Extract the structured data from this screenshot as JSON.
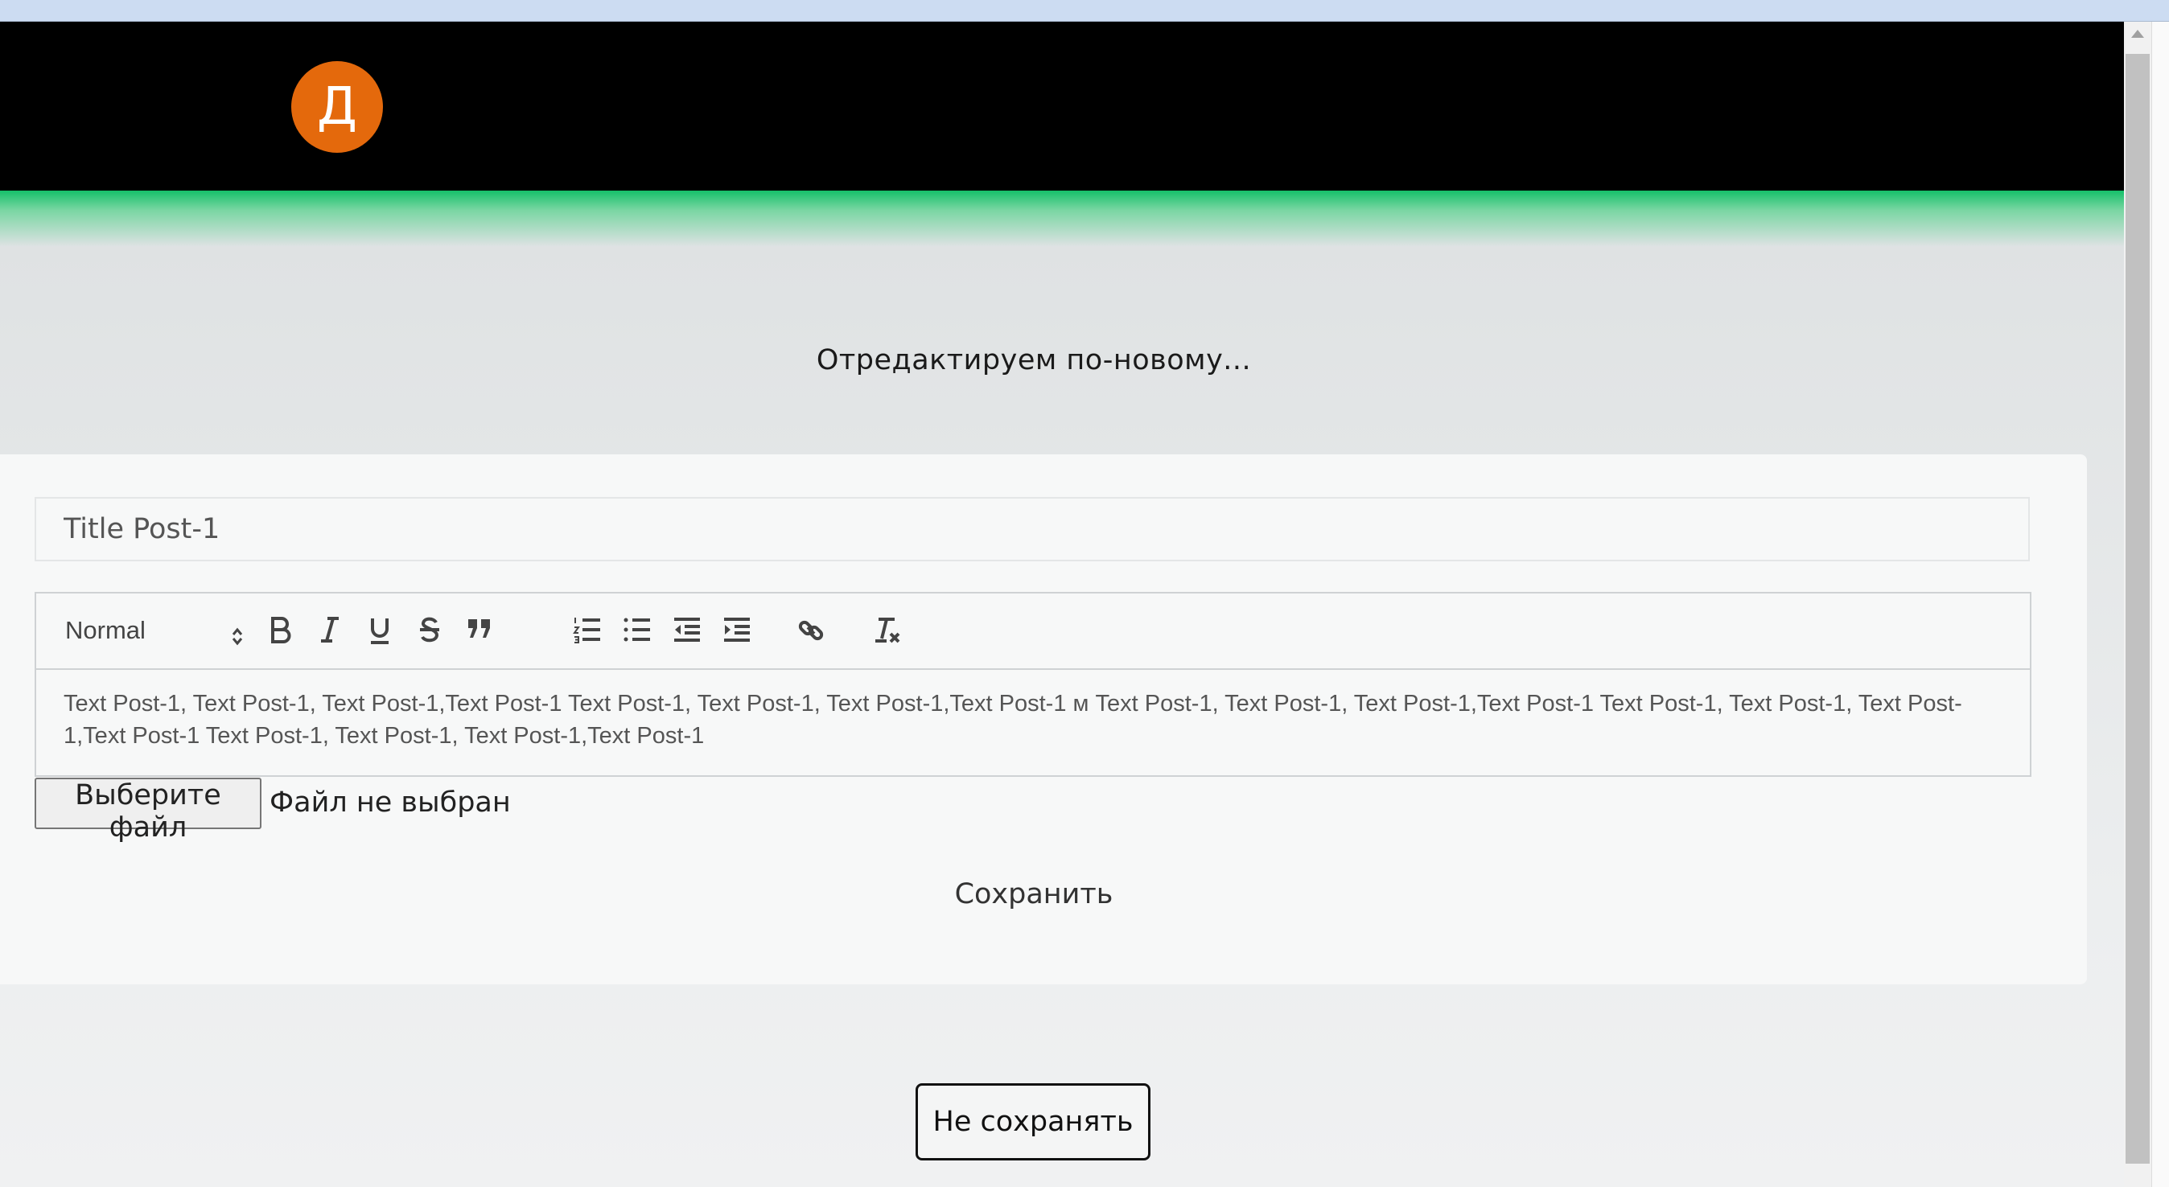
{
  "header": {
    "avatar_letter": "Д",
    "avatar_color": "#e4690c",
    "accent_color": "#16c06a"
  },
  "page": {
    "title": "Отредактируем по-новому..."
  },
  "form": {
    "title_value": "Title Post-1",
    "editor": {
      "format_label": "Normal",
      "tools": [
        "bold-icon",
        "italic-icon",
        "underline-icon",
        "strike-icon",
        "quote-icon",
        "ordered-list-icon",
        "bullet-list-icon",
        "outdent-icon",
        "indent-icon",
        "link-icon",
        "clear-format-icon"
      ],
      "content": "Text Post-1, Text Post-1, Text Post-1,Text Post-1 Text Post-1, Text Post-1, Text Post-1,Text Post-1 м Text Post-1, Text Post-1, Text Post-1,Text Post-1 Text Post-1, Text Post-1, Text Post-1,Text Post-1 Text Post-1, Text Post-1, Text Post-1,Text Post-1"
    },
    "file": {
      "button_label": "Выберите файл",
      "status": "Файл не выбран"
    },
    "save_label": "Сохранить"
  },
  "actions": {
    "cancel_label": "Не сохранять"
  }
}
